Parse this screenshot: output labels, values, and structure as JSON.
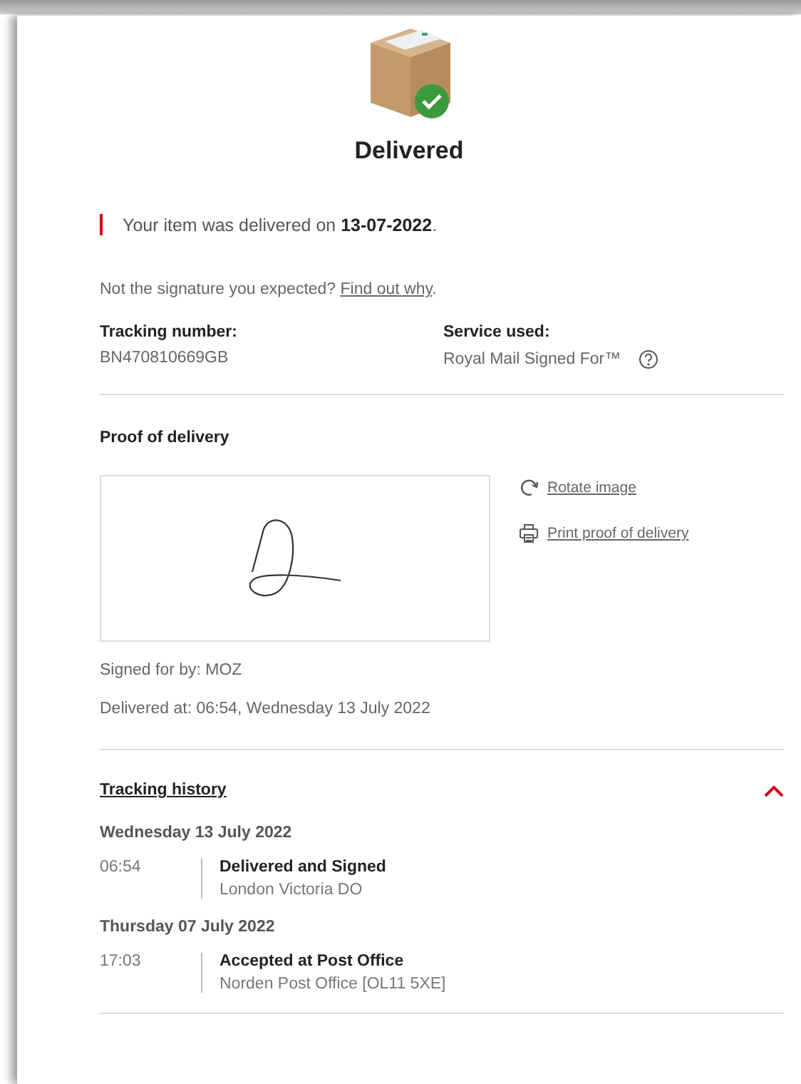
{
  "status": {
    "title": "Delivered"
  },
  "message": {
    "text": "Your item was delivered on **13-07-2022**."
  },
  "signature_note": {
    "text": "Not the signature you expected?",
    "link": "Find out why",
    "after": "."
  },
  "details": [
    {
      "label": "Tracking number:",
      "value": "BN470810669GB",
      "help": false
    },
    {
      "label": "Service used:",
      "value": "Royal Mail Signed For™",
      "help": true
    }
  ],
  "proof": {
    "title": "Proof of delivery",
    "actions": [
      {
        "kind": "rotate",
        "label": "Rotate image"
      },
      {
        "kind": "print",
        "label": "Print proof of delivery"
      }
    ],
    "signed_for": "Signed for by: MOZ",
    "delivered_at": "Delivered at: 06:54, Wednesday 13 July 2022"
  },
  "history": {
    "title": "Tracking history",
    "expanded": true,
    "days": [
      {
        "date": "Wednesday 13 July 2022",
        "events": [
          {
            "time": "06:54",
            "status": "Delivered and Signed",
            "location": "London Victoria DO"
          }
        ]
      },
      {
        "date": "Thursday 07 July 2022",
        "events": [
          {
            "time": "17:03",
            "status": "Accepted at Post Office",
            "location": "Norden Post Office [OL11 5XE]"
          }
        ]
      }
    ]
  }
}
